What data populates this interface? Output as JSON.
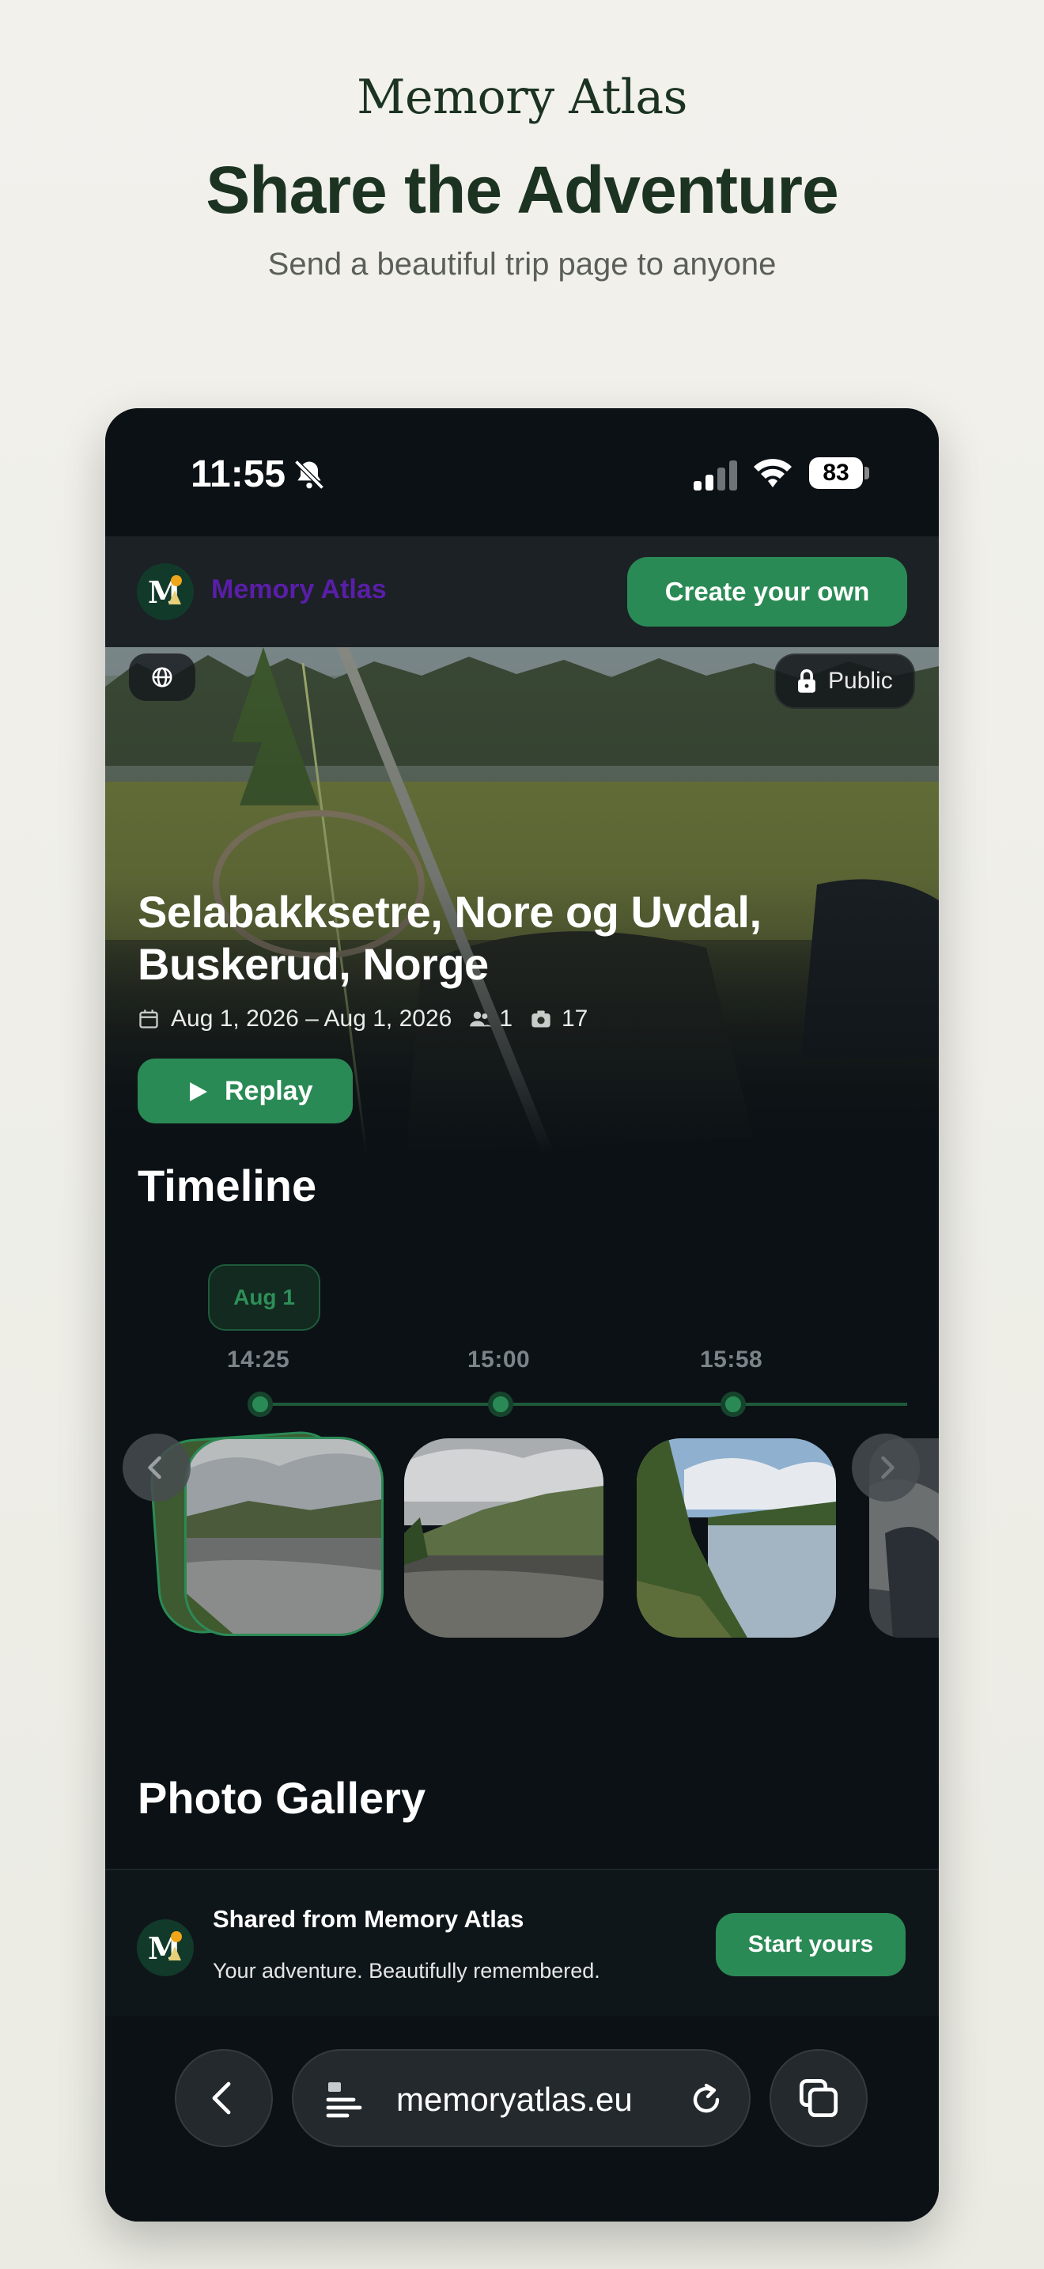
{
  "promo": {
    "brand": "Memory Atlas",
    "title": "Share the Adventure",
    "subtitle": "Send a beautiful trip page to anyone"
  },
  "status_bar": {
    "time": "11:55",
    "battery": "83"
  },
  "header": {
    "brand": "Memory Atlas",
    "create_label": "Create your own",
    "brand_color": "#5a1ea8",
    "accent": "#2a8a55"
  },
  "hero": {
    "visibility": "Public",
    "title": "Selabakksetre, Nore og Uvdal, Buskerud, Norge",
    "dates": "Aug 1, 2026 – Aug 1, 2026",
    "people_count": "1",
    "photo_count": "17",
    "replay_label": "Replay"
  },
  "timeline": {
    "title": "Timeline",
    "day": "Aug 1",
    "times": [
      "14:25",
      "15:00",
      "15:58"
    ]
  },
  "gallery": {
    "title": "Photo Gallery"
  },
  "share_footer": {
    "title": "Shared from Memory Atlas",
    "subtitle": "Your adventure. Beautifully remembered.",
    "start_label": "Start yours"
  },
  "browser": {
    "url": "memoryatlas.eu"
  }
}
